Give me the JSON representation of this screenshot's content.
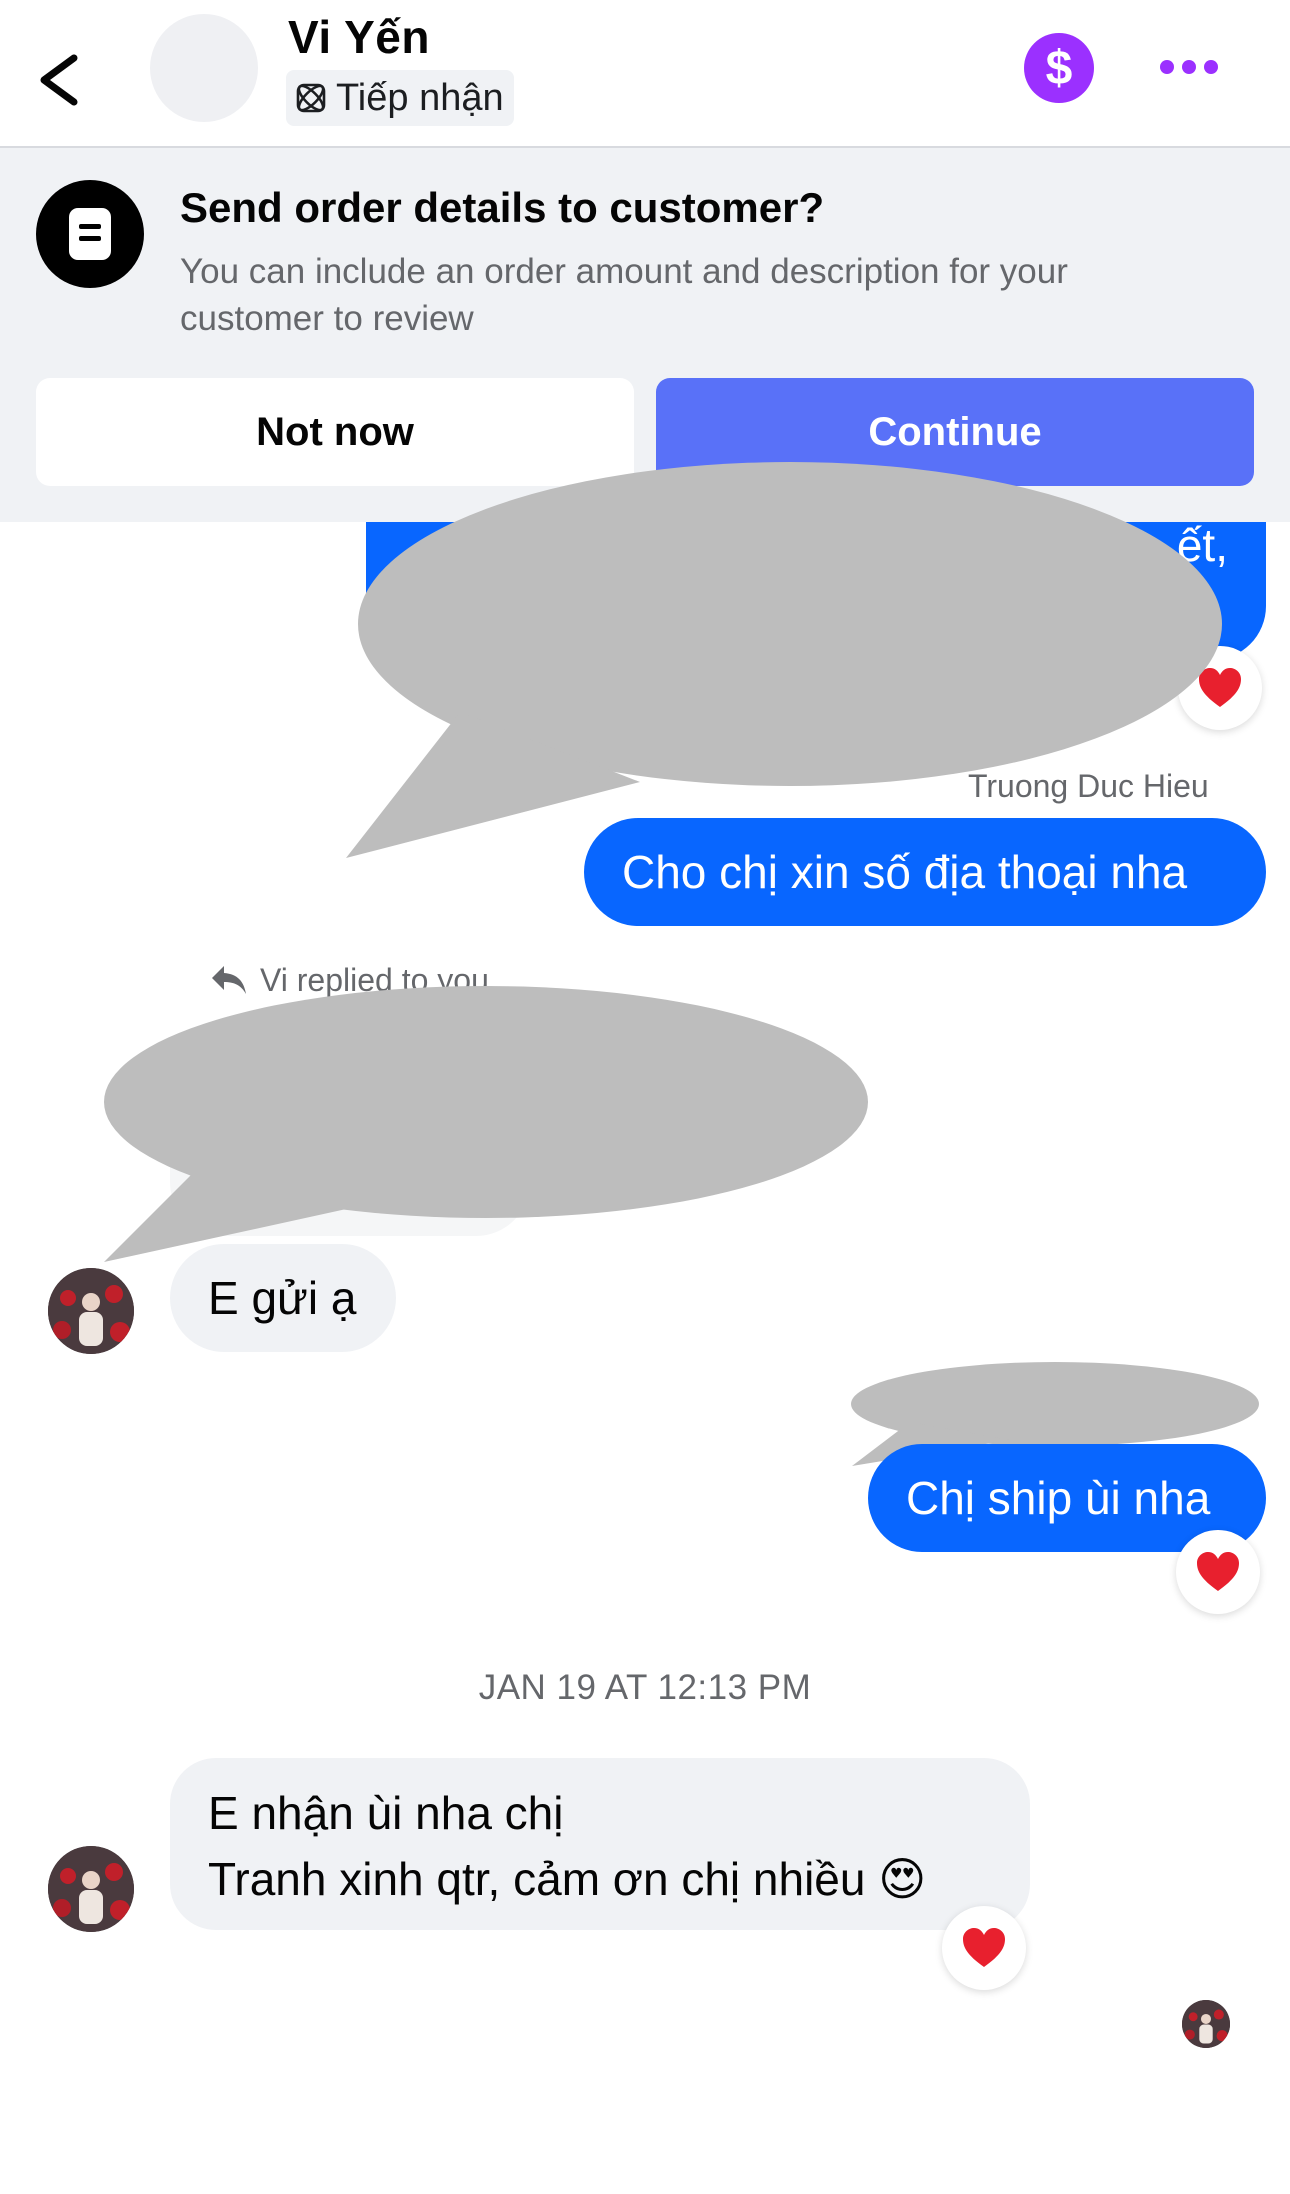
{
  "header": {
    "contact_name": "Vi Yến",
    "status_label": "Tiếp nhận",
    "payment_icon": "dollar-circle-icon",
    "more_icon": "more-dots-icon",
    "accent_color": "#9b30ff"
  },
  "order_banner": {
    "title": "Send order details to customer?",
    "description": "You can include an order amount and description for your customer to review",
    "not_now_label": "Not now",
    "continue_label": "Continue",
    "continue_color": "#5971f8"
  },
  "messages": {
    "partial_outgoing_fragment": "ết,",
    "sender_name": "Truong Duc Hieu",
    "outgoing_1": "Cho chị xin số địa thoại nha",
    "replied_label": "Vi replied to you",
    "incoming_1": "E gửi ạ",
    "outgoing_2": "Chị ship ùi nha",
    "timestamp": "JAN 19 AT 12:13 PM",
    "incoming_2_line1": "E nhận ùi nha chị",
    "incoming_2_line2": "Tranh xinh qtr, cảm ơn chị nhiều",
    "incoming_2_emoji": "😍",
    "reaction": "❤️",
    "outgoing_color": "#0866ff",
    "incoming_color": "#f0f2f5"
  }
}
